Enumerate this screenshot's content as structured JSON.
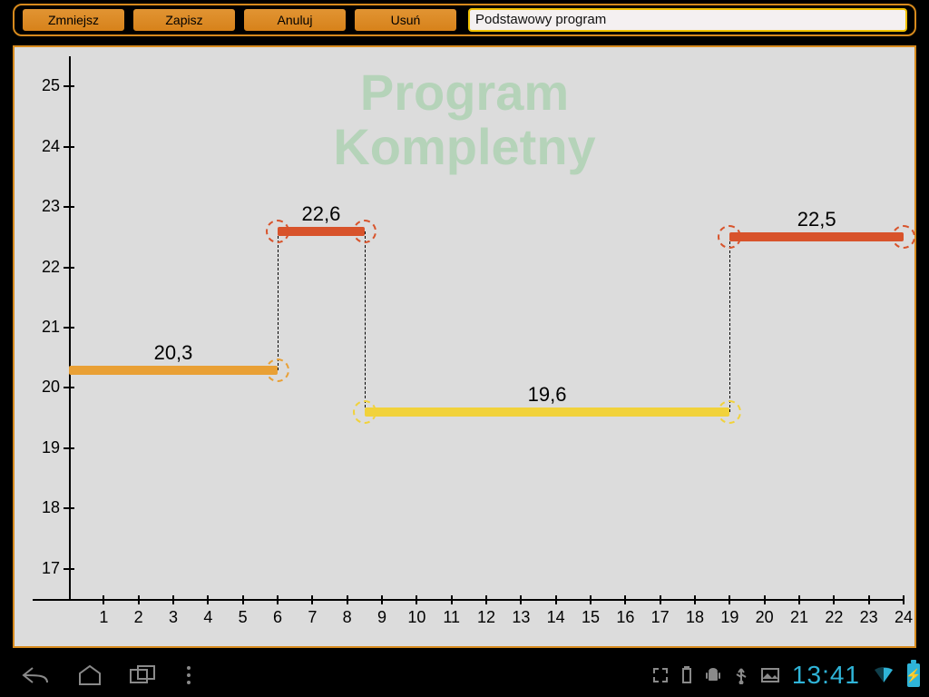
{
  "toolbar": {
    "reduce_label": "Zmniejsz",
    "save_label": "Zapisz",
    "cancel_label": "Anuluj",
    "delete_label": "Usuń",
    "program_name": "Podstawowy program"
  },
  "watermark_line1": "Program",
  "watermark_line2": "Kompletny",
  "statusbar": {
    "clock": "13:41"
  },
  "chart_data": {
    "type": "step",
    "xlabel": "",
    "ylabel": "",
    "x_ticks": [
      1,
      2,
      3,
      4,
      5,
      6,
      7,
      8,
      9,
      10,
      11,
      12,
      13,
      14,
      15,
      16,
      17,
      18,
      19,
      20,
      21,
      22,
      23,
      24
    ],
    "y_ticks": [
      17,
      18,
      19,
      20,
      21,
      22,
      23,
      24,
      25
    ],
    "xlim": [
      0,
      24
    ],
    "ylim": [
      16.5,
      25.5
    ],
    "segments": [
      {
        "start": 0,
        "end": 6,
        "value": 20.3,
        "label": "20,3",
        "color": "orange"
      },
      {
        "start": 6,
        "end": 8.5,
        "value": 22.6,
        "label": "22,6",
        "color": "red"
      },
      {
        "start": 8.5,
        "end": 19,
        "value": 19.6,
        "label": "19,6",
        "color": "yellow"
      },
      {
        "start": 19,
        "end": 24,
        "value": 22.5,
        "label": "22,5",
        "color": "red"
      }
    ]
  }
}
